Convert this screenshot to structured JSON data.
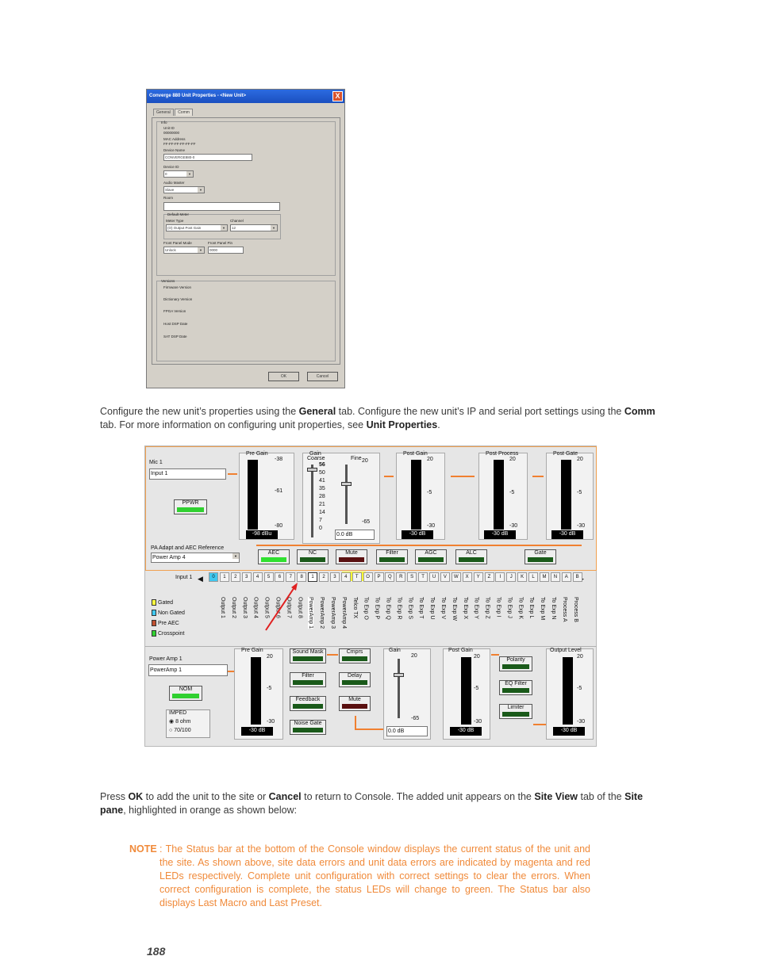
{
  "dialog": {
    "title": "Converge 880 Unit Properties - <New Unit>",
    "close_glyph": "X",
    "tabs": [
      "General",
      "Comm"
    ],
    "info_label": "Info",
    "unit_id_label": "Unit ID",
    "unit_id": "00000000",
    "mac_label": "MAC Address",
    "mac": "FF-FF-FF-FF-FF-FF",
    "device_name_label": "Device Name",
    "device_name": "CONVERGE880-0",
    "device_id_label": "Device ID",
    "device_id": "0",
    "audio_master_label": "Audio Master",
    "audio_master": "Slave",
    "room_label": "Room",
    "room": "",
    "default_meter_label": "Default Meter",
    "meter_type_label": "Meter Type",
    "meter_type": "(O) Output Post Gain",
    "channel_label": "Channel",
    "channel": "12",
    "front_panel_mode_label": "Front Panel Mode",
    "front_panel_mode": "Unlock",
    "front_panel_pin_label": "Front Panel Pin",
    "front_panel_pin": "0000",
    "versions_label": "Versions",
    "versions": [
      "Firmware Version",
      "Dictionary Version",
      "FPGA Version",
      "Host DSP Date",
      "SAT DSP Date"
    ],
    "ok": "OK",
    "cancel": "Cancel"
  },
  "para1": {
    "t1": "Configure the new unit’s properties using the ",
    "b1": "General",
    "t2": " tab. Configure the new unit’s IP and serial port settings using the ",
    "b2": "Comm",
    "t3": " tab. For more information on configuring unit properties, see ",
    "b3": "Unit Properties",
    "t4": "."
  },
  "diagram": {
    "mic_label": "Mic 1",
    "mic_input": "Input 1",
    "ppwr": "PPWR",
    "pre_gain": "Pre Gain",
    "pre_gain_ticks": [
      "-38",
      "-61",
      "-80"
    ],
    "pre_gain_value": "-98 dBu",
    "gain_label": "Gain",
    "coarse_label": "Coarse",
    "fine_label": "Fine",
    "coarse_ticks": [
      "56",
      "50",
      "41",
      "35",
      "28",
      "21",
      "14",
      "7",
      "0"
    ],
    "fine_ticks": [
      "20",
      "-65"
    ],
    "fine_value": "0.0 dB",
    "post_gain": "Post Gain",
    "post_process": "Post Process",
    "post_gate": "Post Gate",
    "meter_ticks": [
      "20",
      "-5",
      "-30"
    ],
    "meter_value": "-30 dB",
    "pa_label": "PA Adapt and AEC Reference",
    "pa_value": "Power Amp 4",
    "blocks": [
      "AEC",
      "NC",
      "Mute",
      "Filter",
      "AGC",
      "ALC",
      "Gate"
    ],
    "input_label": "Input 1",
    "channels": [
      "0",
      "1",
      "2",
      "3",
      "4",
      "5",
      "6",
      "7",
      "8",
      "1",
      "2",
      "3",
      "4",
      "T",
      "O",
      "P",
      "Q",
      "R",
      "S",
      "T",
      "U",
      "V",
      "W",
      "X",
      "Y",
      "Z",
      "I",
      "J",
      "K",
      "L",
      "M",
      "N",
      "A",
      "B"
    ],
    "yellow_labels": [
      "0",
      "0"
    ],
    "outputs": [
      "Output 1",
      "Output 2",
      "Output 3",
      "Output 4",
      "Output 5",
      "Output 6",
      "Output 7",
      "Output 8",
      "PowerAmp 1",
      "PowerAmp 2",
      "PowerAmp 3",
      "PowerAmp 4",
      "Telco TX",
      "To Exp O",
      "To Exp P",
      "To Exp Q",
      "To Exp R",
      "To Exp S",
      "To Exp T",
      "To Exp U",
      "To Exp V",
      "To Exp W",
      "To Exp X",
      "To Exp Y",
      "To Exp Z",
      "To Exp I",
      "To Exp J",
      "To Exp K",
      "To Exp L",
      "To Exp M",
      "To Exp N",
      "Process A",
      "Process B"
    ],
    "legend": [
      {
        "label": "Gated",
        "color": "#ffff40"
      },
      {
        "label": "Non Gated",
        "color": "#40c8f0"
      },
      {
        "label": "Pre AEC",
        "color": "#c05030"
      },
      {
        "label": "Crosspoint",
        "color": "#30d030"
      }
    ],
    "amp_label": "Power Amp 1",
    "amp_input": "PowerAmp 1",
    "nom": "NOM",
    "imped": "IMPED",
    "ohm8": "8 ohm",
    "ohm70": "70/100",
    "pre_gain2_ticks": [
      "20",
      "-5",
      "-30"
    ],
    "amp_blocks_left": [
      "Sound Mask",
      "Filter",
      "Feedback",
      "Noise Gate"
    ],
    "amp_blocks_mid": [
      "Cmprs",
      "Delay",
      "Mute"
    ],
    "amp_blocks_right": [
      "Polarity",
      "EQ Filter",
      "Limiter"
    ],
    "gain2_ticks": [
      "20",
      "-65"
    ],
    "gain2_value": "0.0 dB",
    "output_level": "Output Level"
  },
  "para2": {
    "t1": "Press ",
    "b1": "OK",
    "t2": " to add the unit to the site or ",
    "b2": "Cancel",
    "t3": " to return to Console. The added unit appears on the ",
    "b3": "Site View",
    "t4": " tab of the ",
    "b4": "Site pane",
    "t5": ", highlighted in orange as shown below:"
  },
  "note": {
    "head": "NOTE",
    "body": ": The Status bar at the bottom of the Console window displays the current status of the unit and the site. As shown above, site data errors and unit data errors are indicated by magenta and red LEDs respectively. Complete unit configuration with correct settings to clear the errors. When correct configuration is complete, the status LEDs will change to green. The Status bar also displays Last Macro and Last Preset."
  },
  "page_number": "188"
}
